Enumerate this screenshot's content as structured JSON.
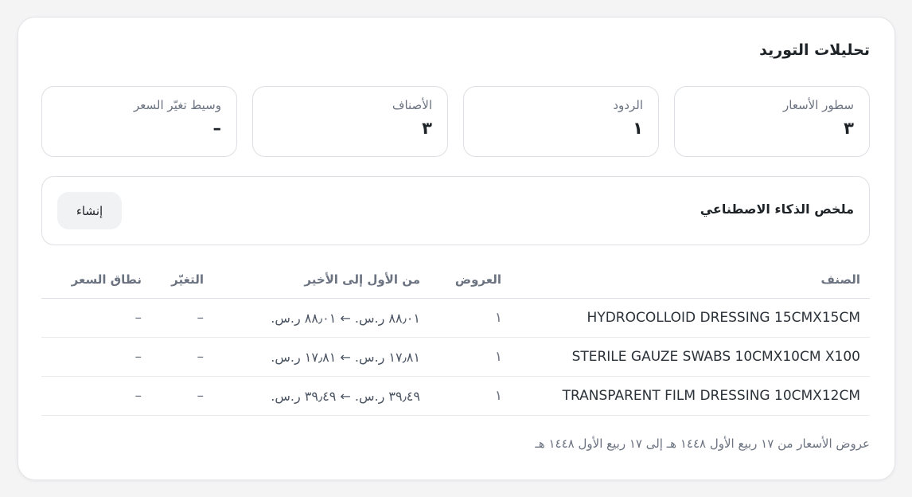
{
  "title": "تحليلات التوريد",
  "stats": [
    {
      "label": "سطور الأسعار",
      "value": "٣"
    },
    {
      "label": "الردود",
      "value": "١"
    },
    {
      "label": "الأصناف",
      "value": "٣"
    },
    {
      "label": "وسيط تغيّر السعر",
      "value": "–"
    }
  ],
  "ai_summary": {
    "title": "ملخص الذكاء الاصطناعي",
    "button_label": "إنشاء"
  },
  "table": {
    "headers": {
      "item": "الصنف",
      "offers": "العروض",
      "range": "من الأول إلى الأخير",
      "change": "التغيّر",
      "band": "نطاق السعر"
    },
    "rows": [
      {
        "item": "HYDROCOLLOID DRESSING 15CMX15CM",
        "offers": "١",
        "range": "٨٨٫٠١ ر.س. ← ٨٨٫٠١ ر.س.",
        "change": "–",
        "band": "–"
      },
      {
        "item": "STERILE GAUZE SWABS 10CMX10CM X100",
        "offers": "١",
        "range": "١٧٫٨١ ر.س. ← ١٧٫٨١ ر.س.",
        "change": "–",
        "band": "–"
      },
      {
        "item": "TRANSPARENT FILM DRESSING 10CMX12CM",
        "offers": "١",
        "range": "٣٩٫٤٩ ر.س. ← ٣٩٫٤٩ ر.س.",
        "change": "–",
        "band": "–"
      }
    ]
  },
  "footer": "عروض الأسعار من ١٧ ربيع الأول ١٤٤٨ هـ إلى ١٧ ربيع الأول ١٤٤٨ هـ"
}
